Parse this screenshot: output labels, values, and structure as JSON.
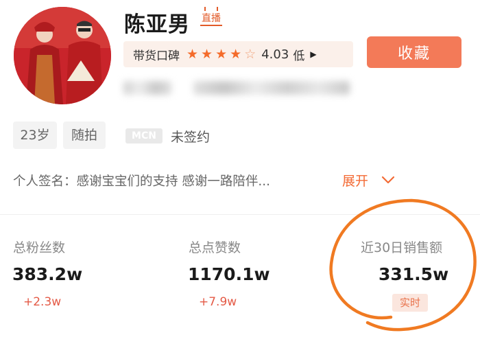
{
  "profile": {
    "name": "陈亚男",
    "live_badge": "直播",
    "avatar_alt": "avatar",
    "follow_label": "收藏"
  },
  "rating": {
    "label": "带货口碑",
    "score": "4.03",
    "level": "低",
    "stars_filled": 4,
    "stars_total": 5
  },
  "tags": {
    "age": "23岁",
    "type": "随拍",
    "mcn_label": "MCN",
    "mcn_status": "未签约"
  },
  "signature": {
    "text": "个人签名：感谢宝宝们的支持 感谢一路陪伴...",
    "expand_label": "展开"
  },
  "stats": [
    {
      "label": "总粉丝数",
      "value": "383.2w",
      "delta": "+2.3w"
    },
    {
      "label": "总点赞数",
      "value": "1170.1w",
      "delta": "+7.9w"
    },
    {
      "label": "近30日销售额",
      "value": "331.5w",
      "badge": "实时"
    }
  ],
  "colors": {
    "accent": "#f37a58",
    "star": "#f46b2a",
    "annotation_circle": "#f07a22",
    "avatar_bg": "#c9242b"
  }
}
